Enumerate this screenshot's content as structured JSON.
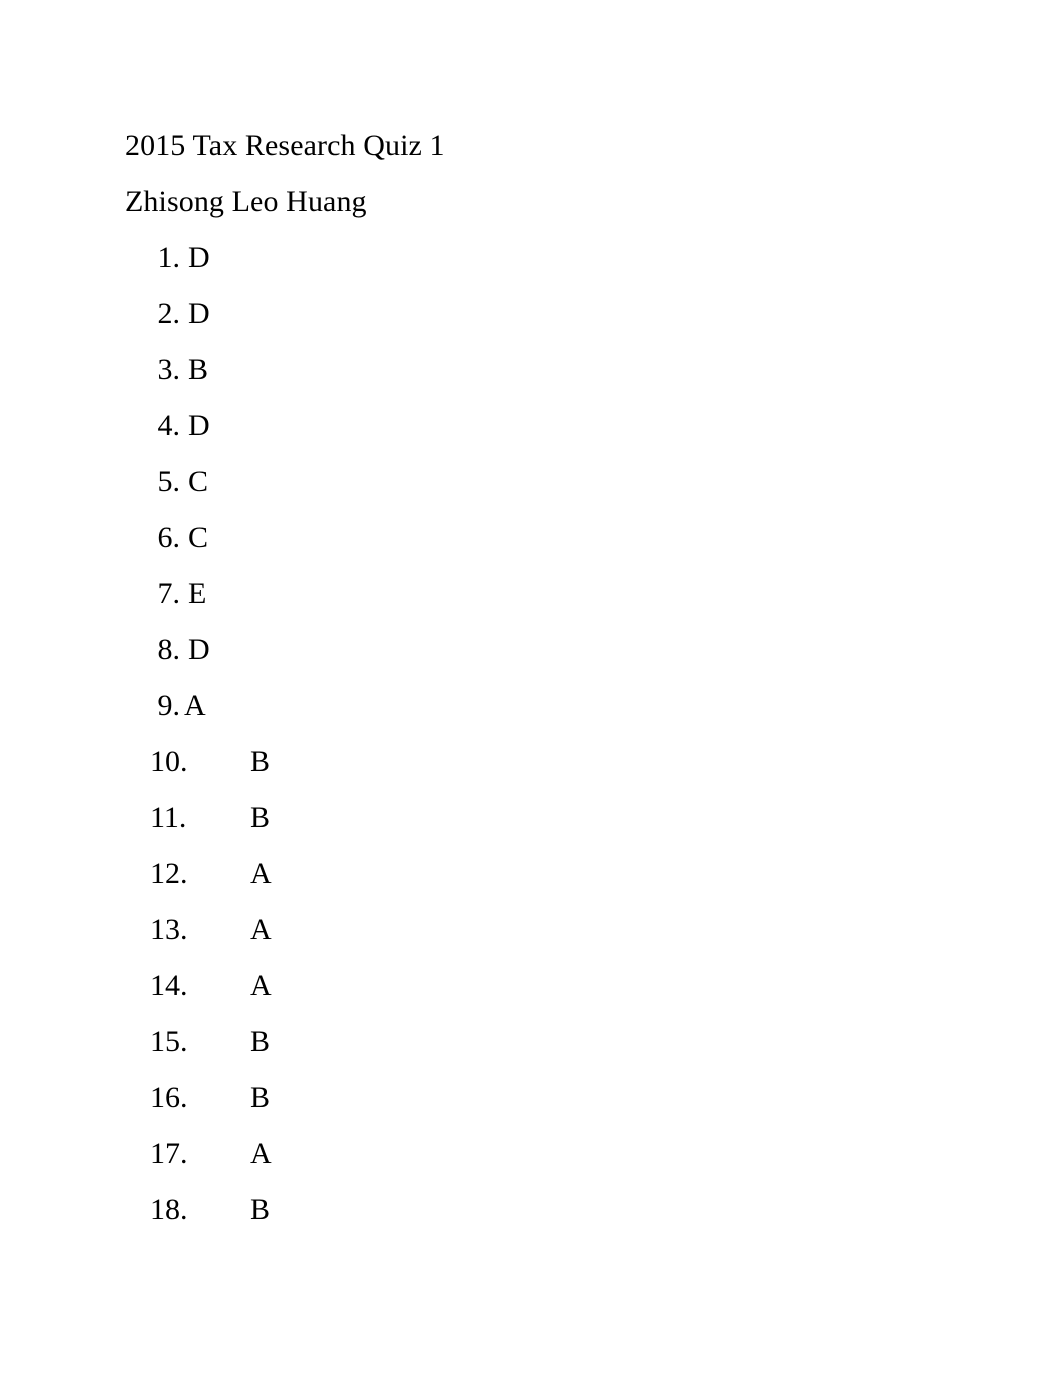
{
  "document": {
    "title_line": "2015 Tax Research Quiz 1",
    "author_line": "Zhisong Leo Huang",
    "text_color": "#000000",
    "background_color": "#ffffff",
    "answers": [
      {
        "number": "1.",
        "answer": "D"
      },
      {
        "number": "2.",
        "answer": "D"
      },
      {
        "number": "3.",
        "answer": "B"
      },
      {
        "number": "4.",
        "answer": "D"
      },
      {
        "number": "5.",
        "answer": "C"
      },
      {
        "number": "6.",
        "answer": "C"
      },
      {
        "number": "7.",
        "answer": "E"
      },
      {
        "number": "8.",
        "answer": "D"
      },
      {
        "number": "9.",
        "answer": "A"
      },
      {
        "number": "10.",
        "answer": "B"
      },
      {
        "number": "11.",
        "answer": "B"
      },
      {
        "number": "12.",
        "answer": "A"
      },
      {
        "number": "13.",
        "answer": "A"
      },
      {
        "number": "14.",
        "answer": "A"
      },
      {
        "number": "15.",
        "answer": "B"
      },
      {
        "number": "16.",
        "answer": "B"
      },
      {
        "number": "17.",
        "answer": "A"
      },
      {
        "number": "18.",
        "answer": "B"
      }
    ]
  }
}
